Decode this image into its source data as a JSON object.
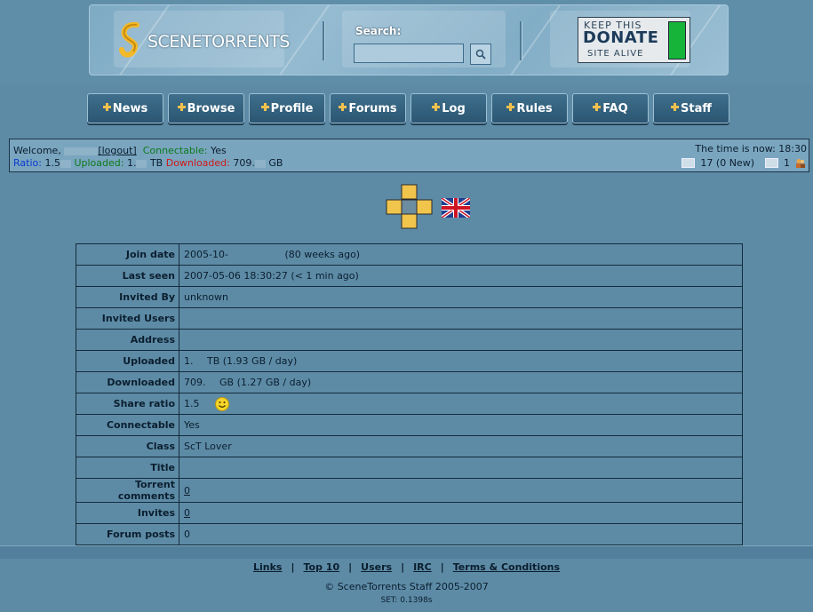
{
  "header": {
    "logo_text": "SCENETORRENTS",
    "search_label": "Search:",
    "search_value": "",
    "donate": {
      "line1": "KEEP THIS",
      "line2": "DONATE",
      "line3": "SITE ALIVE"
    }
  },
  "nav": [
    {
      "label": "News"
    },
    {
      "label": "Browse"
    },
    {
      "label": "Profile"
    },
    {
      "label": "Forums"
    },
    {
      "label": "Log"
    },
    {
      "label": "Rules"
    },
    {
      "label": "FAQ"
    },
    {
      "label": "Staff"
    }
  ],
  "status": {
    "welcome": "Welcome,",
    "logout": "[logout]",
    "connectable_label": "Connectable:",
    "connectable_value": "Yes",
    "ratio_label": "Ratio:",
    "ratio_value": "1.5",
    "uploaded_label": "Uploaded:",
    "uploaded_value": "1.",
    "uploaded_unit": "TB",
    "downloaded_label": "Downloaded:",
    "downloaded_value": "709.",
    "downloaded_unit": "GB",
    "time_text": "The time is now: 18:30",
    "messages": "17 (0 New)",
    "sent": "1"
  },
  "profile": {
    "rows": [
      {
        "key": "Join date",
        "value": "2005-10-",
        "extra": "(80 weeks ago)"
      },
      {
        "key": "Last seen",
        "value": "2007-05-06 18:30:27 (< 1 min ago)"
      },
      {
        "key": "Invited By",
        "value": "unknown"
      },
      {
        "key": "Invited Users",
        "value": ""
      },
      {
        "key": "Address",
        "value": ""
      },
      {
        "key": "Uploaded",
        "value": "1.",
        "extra": "TB (1.93 GB / day)"
      },
      {
        "key": "Downloaded",
        "value": "709.",
        "extra": "GB (1.27 GB / day)"
      },
      {
        "key": "Share ratio",
        "value": "1.5"
      },
      {
        "key": "Connectable",
        "value": "Yes"
      },
      {
        "key": "Class",
        "value": "ScT Lover"
      },
      {
        "key": "Title",
        "value": ""
      },
      {
        "key": "Torrent comments",
        "value": "0"
      },
      {
        "key": "Invites",
        "value": "0"
      },
      {
        "key": "Forum posts",
        "value": "0"
      }
    ]
  },
  "footer": {
    "links": [
      "Links",
      "Top 10",
      "Users",
      "IRC",
      "Terms & Conditions"
    ],
    "separator": "|",
    "copyright": "© SceneTorrents Staff 2005-2007",
    "timing": "SET: 0.1398s"
  },
  "colors": {
    "background": "#5d8ba6",
    "nav_button": "#2f5a76",
    "accent": "#f2c14e"
  }
}
